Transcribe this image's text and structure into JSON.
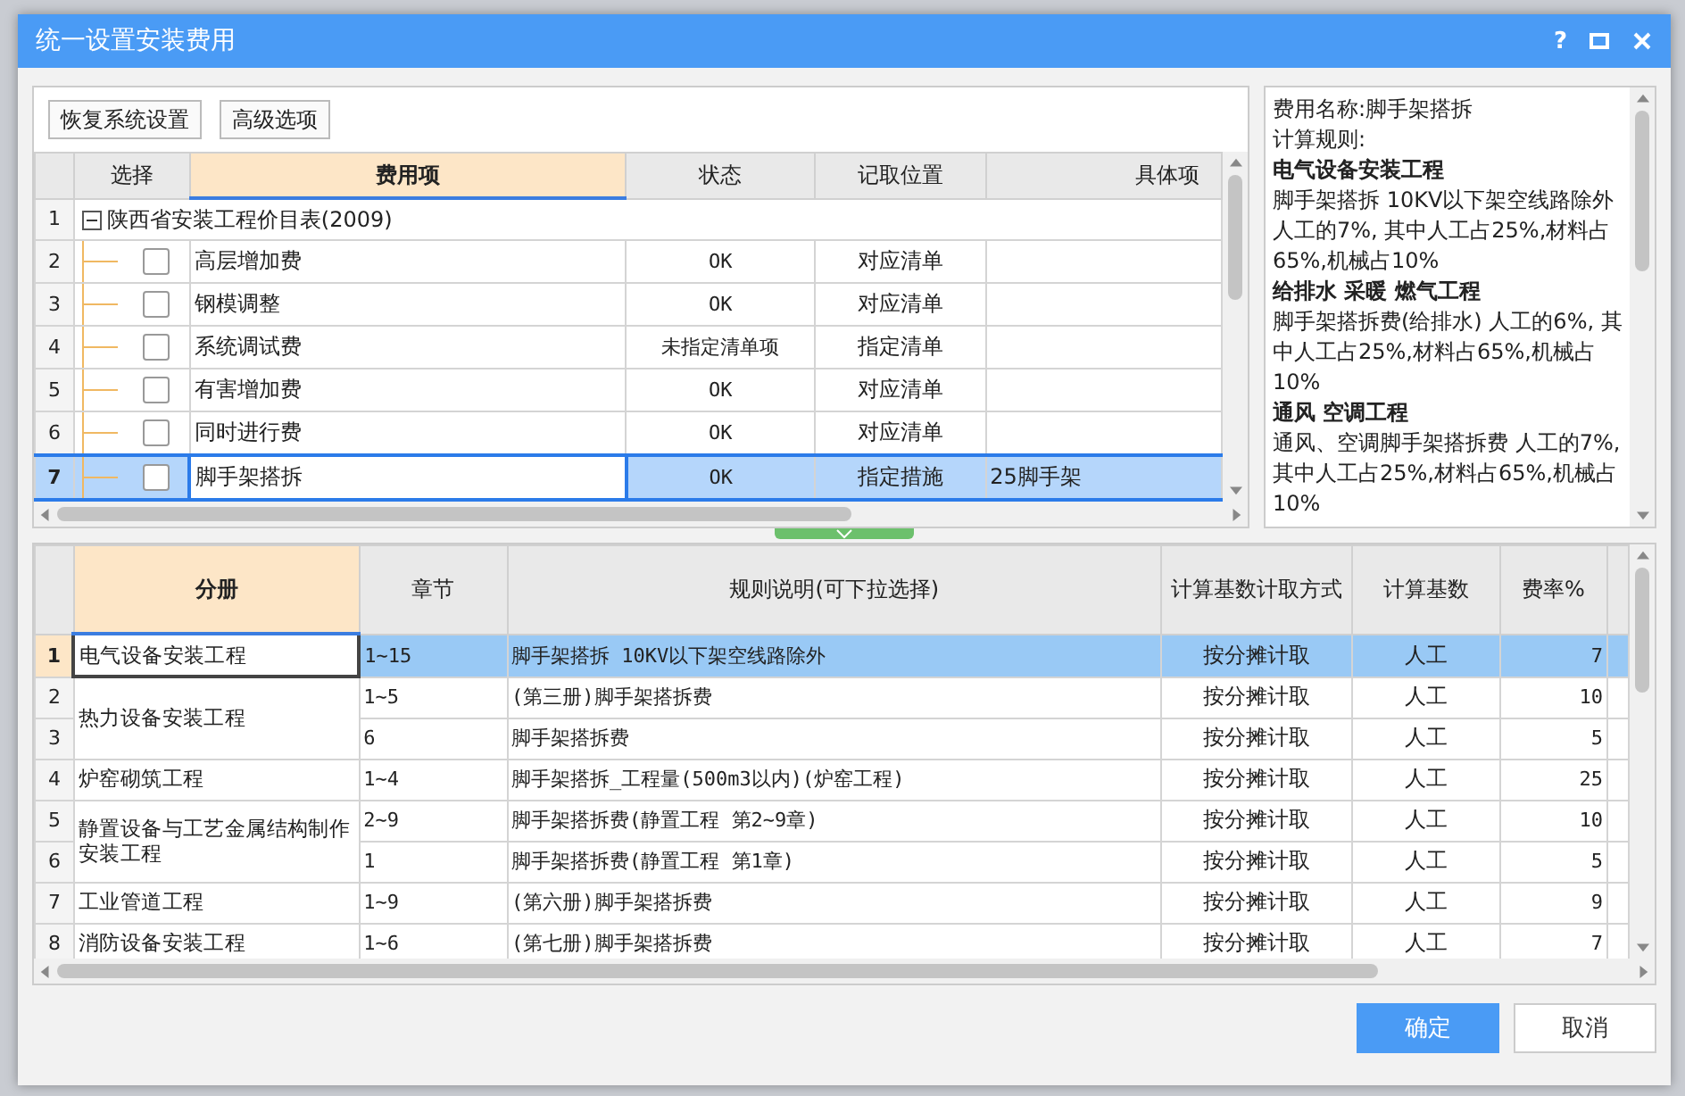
{
  "window": {
    "title": "统一设置安装费用",
    "controls": [
      "?"
    ]
  },
  "toolbar": {
    "buttons": [
      "恢复系统设置",
      "高级选项"
    ]
  },
  "fee_table": {
    "columns": [
      "选择",
      "费用项",
      "状态",
      "记取位置",
      "具体项"
    ],
    "root": {
      "num": "1",
      "name": "陕西省安装工程价目表(2009)",
      "expanded": true,
      "children": [
        {
          "num": "2",
          "checked": false,
          "name": "高层增加费",
          "status": "OK",
          "position": "对应清单",
          "selected": false
        },
        {
          "num": "3",
          "checked": false,
          "name": "钢模调整",
          "status": "OK",
          "position": "对应清单",
          "selected": false
        },
        {
          "num": "4",
          "checked": false,
          "name": "系统调试费",
          "status": "未指定清单项",
          "position": "指定清单",
          "selected": false
        },
        {
          "num": "5",
          "checked": false,
          "name": "有害增加费",
          "status": "OK",
          "position": "对应清单",
          "selected": false
        },
        {
          "num": "6",
          "checked": false,
          "name": "同时进行费",
          "status": "OK",
          "position": "对应清单",
          "selected": false
        },
        {
          "num": "7",
          "checked": false,
          "name": "脚手架搭拆",
          "status": "OK",
          "position": "指定措施",
          "item": "25脚手架",
          "selected": true
        }
      ]
    }
  },
  "info_panel": {
    "lines": [
      {
        "kind": "text",
        "text": "费用名称:脚手架搭拆"
      },
      {
        "kind": "text",
        "text": "计算规则:"
      },
      {
        "kind": "heading",
        "text": "电气设备安装工程"
      },
      {
        "kind": "text",
        "text": "脚手架搭拆 10KV以下架空线路除外人工的7%, 其中人工占25%,材料占65%,机械占10%"
      },
      {
        "kind": "heading",
        "text": "给排水 采暖 燃气工程"
      },
      {
        "kind": "text",
        "text": "脚手架搭拆费(给排水) 人工的6%, 其中人工占25%,材料占65%,机械占10%"
      },
      {
        "kind": "heading",
        "text": "通风 空调工程"
      },
      {
        "kind": "text",
        "text": "通风、空调脚手架搭拆费 人工的7%, 其中人工占25%,材料占65%,机械占10%"
      }
    ]
  },
  "rule_table": {
    "columns": [
      "分册",
      "章节",
      "规则说明(可下拉选择)",
      "计算基数计取方式",
      "计算基数",
      "费率%"
    ],
    "groups": [
      {
        "volume": "电气设备安装工程",
        "rows": [
          {
            "num": "1",
            "chapter": "1~15",
            "rule": "脚手架搭拆 10KV以下架空线路除外",
            "method": "按分摊计取",
            "base": "人工",
            "rate": "7",
            "selected": true
          }
        ]
      },
      {
        "volume": "热力设备安装工程",
        "rows": [
          {
            "num": "2",
            "chapter": "1~5",
            "rule": "(第三册)脚手架搭拆费",
            "method": "按分摊计取",
            "base": "人工",
            "rate": "10",
            "selected": false
          },
          {
            "num": "3",
            "chapter": "6",
            "rule": "脚手架搭拆费",
            "method": "按分摊计取",
            "base": "人工",
            "rate": "5",
            "selected": false
          }
        ]
      },
      {
        "volume": "炉窑砌筑工程",
        "rows": [
          {
            "num": "4",
            "chapter": "1~4",
            "rule": "脚手架搭拆_工程量(500m3以内)(炉窑工程)",
            "method": "按分摊计取",
            "base": "人工",
            "rate": "25",
            "selected": false
          }
        ]
      },
      {
        "volume": "静置设备与工艺金属结构制作安装工程",
        "rows": [
          {
            "num": "5",
            "chapter": "2~9",
            "rule": "脚手架搭拆费(静置工程 第2~9章)",
            "method": "按分摊计取",
            "base": "人工",
            "rate": "10",
            "selected": false
          },
          {
            "num": "6",
            "chapter": "1",
            "rule": "脚手架搭拆费(静置工程 第1章)",
            "method": "按分摊计取",
            "base": "人工",
            "rate": "5",
            "selected": false
          }
        ]
      },
      {
        "volume": "工业管道工程",
        "rows": [
          {
            "num": "7",
            "chapter": "1~9",
            "rule": "(第六册)脚手架搭拆费",
            "method": "按分摊计取",
            "base": "人工",
            "rate": "9",
            "selected": false
          }
        ]
      },
      {
        "volume": "消防设备安装工程",
        "rows": [
          {
            "num": "8",
            "chapter": "1~6",
            "rule": "(第七册)脚手架搭拆费",
            "method": "按分摊计取",
            "base": "人工",
            "rate": "7",
            "selected": false
          }
        ]
      }
    ]
  },
  "buttons": [
    {
      "label": "确定",
      "primary": true
    },
    {
      "label": "取消",
      "primary": false
    }
  ]
}
